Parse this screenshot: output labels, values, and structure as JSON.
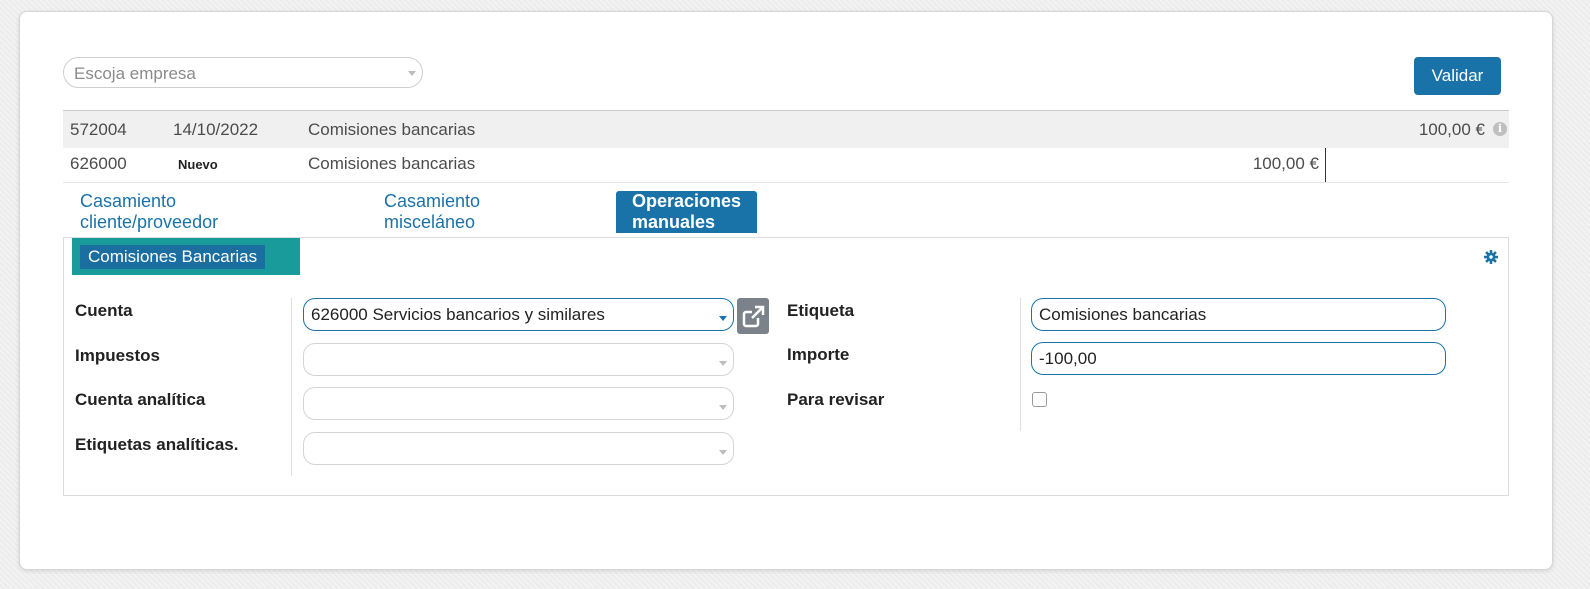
{
  "header": {
    "company_placeholder": "Escoja empresa",
    "validate_label": "Validar"
  },
  "lines": [
    {
      "account": "572004",
      "date": "14/10/2022",
      "label": "Comisiones bancarias",
      "debit": "",
      "credit": "100,00 €"
    },
    {
      "account": "626000",
      "badge": "Nuevo",
      "label": "Comisiones bancarias",
      "debit": "100,00 €",
      "credit": ""
    }
  ],
  "tabs": [
    {
      "label": "Casamiento cliente/proveedor"
    },
    {
      "label": "Casamiento misceláneo"
    },
    {
      "label": "Operaciones manuales",
      "active": true
    }
  ],
  "panel": {
    "model_label": "Comisiones Bancarias",
    "left_fields": [
      {
        "label": "Cuenta",
        "value": "626000 Servicios bancarios y similares"
      },
      {
        "label": "Impuestos",
        "value": ""
      },
      {
        "label": "Cuenta analítica",
        "value": ""
      },
      {
        "label": "Etiquetas analíticas.",
        "value": ""
      }
    ],
    "right_fields": [
      {
        "label": "Etiqueta",
        "value": "Comisiones bancarias"
      },
      {
        "label": "Importe",
        "value": "-100,00"
      },
      {
        "label": "Para revisar",
        "checked": false
      }
    ]
  },
  "colors": {
    "primary": "#1a73a8",
    "model_highlight": "#1a9b9b"
  }
}
